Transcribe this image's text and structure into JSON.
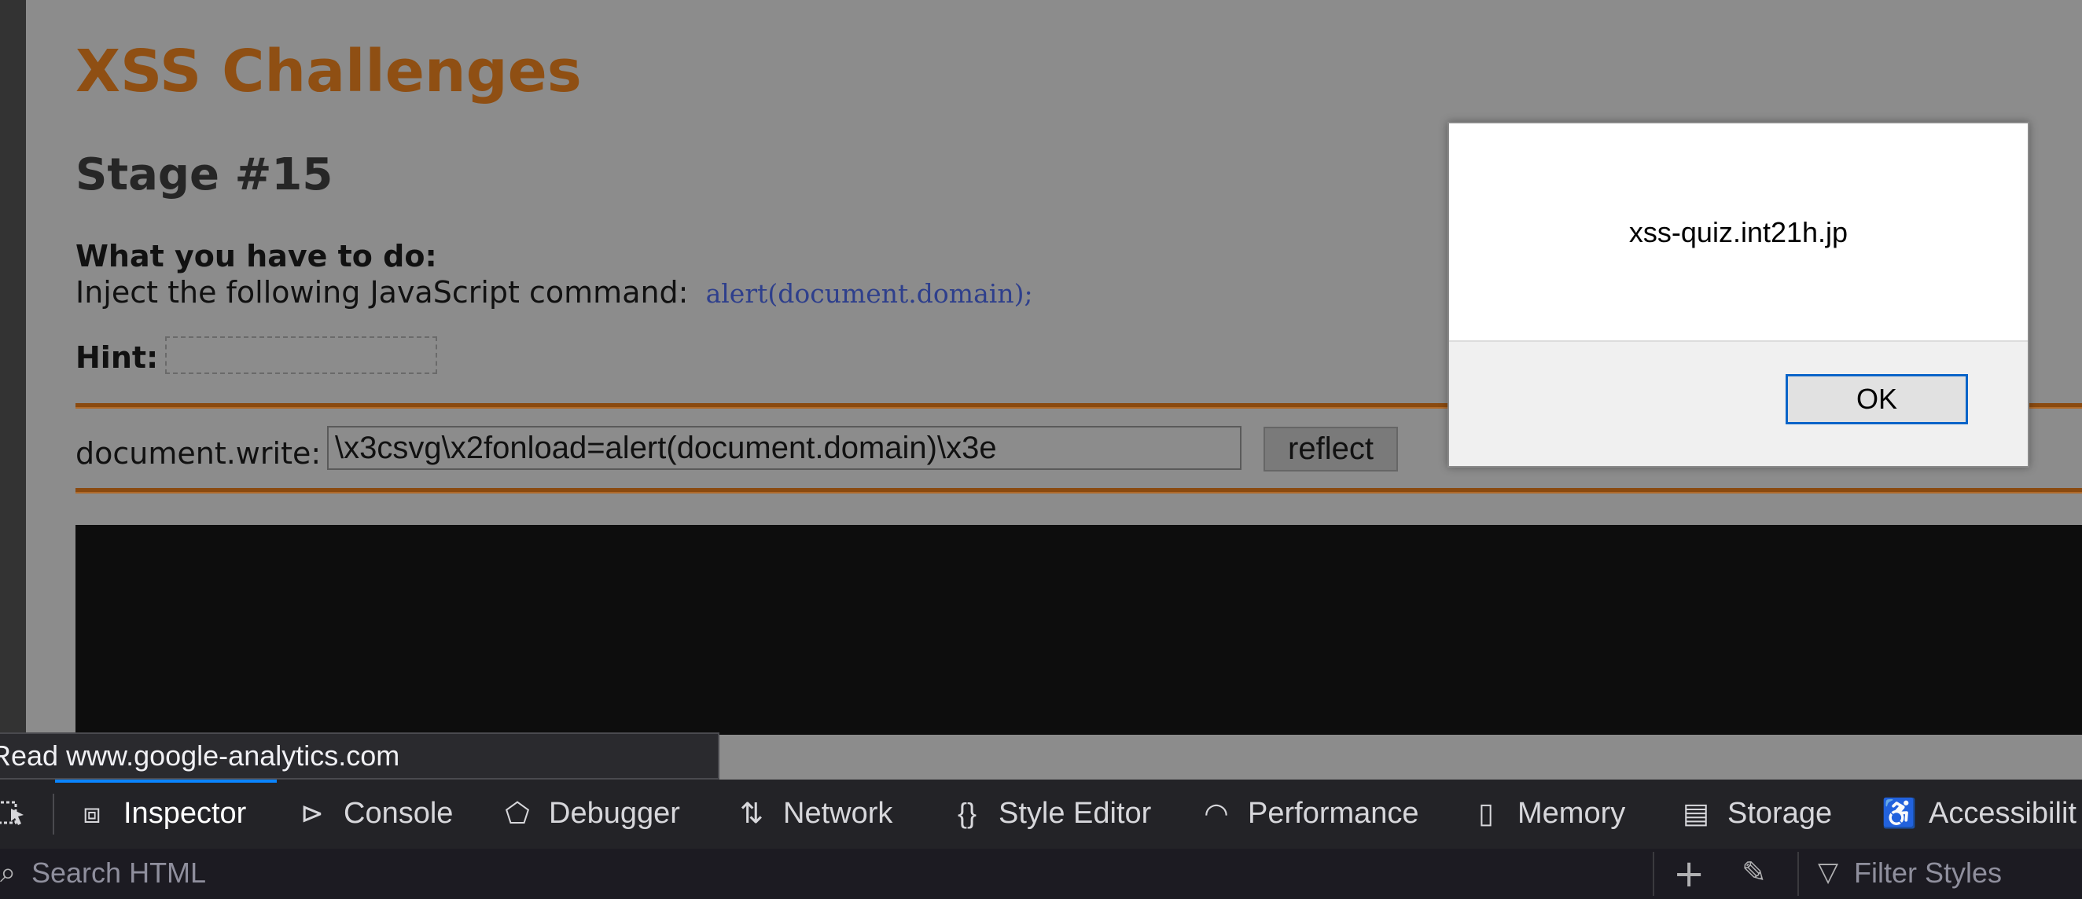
{
  "page": {
    "title": "XSS Challenges",
    "stage": "Stage #15",
    "todo_label": "What you have to do:",
    "instruction_text": "Inject the following JavaScript command:",
    "instruction_code": "alert(document.domain);",
    "hint_label": "Hint:",
    "form": {
      "label": "document.write:",
      "input_value": "\\x3csvg\\x2fonload=alert(document.domain)\\x3e",
      "submit_label": "reflect"
    }
  },
  "alert": {
    "message": "xss-quiz.int21h.jp",
    "ok_label": "OK"
  },
  "status_tip": "Read www.google-analytics.com",
  "devtools": {
    "tabs": [
      {
        "label": "Inspector",
        "icon": "inspector-icon",
        "active": true
      },
      {
        "label": "Console",
        "icon": "console-icon"
      },
      {
        "label": "Debugger",
        "icon": "debugger-icon"
      },
      {
        "label": "Network",
        "icon": "network-icon"
      },
      {
        "label": "Style Editor",
        "icon": "style-editor-icon"
      },
      {
        "label": "Performance",
        "icon": "performance-icon"
      },
      {
        "label": "Memory",
        "icon": "memory-icon"
      },
      {
        "label": "Storage",
        "icon": "storage-icon"
      },
      {
        "label": "Accessibilit",
        "icon": "accessibility-icon"
      }
    ],
    "search_placeholder": "Search HTML",
    "filter_placeholder": "Filter Styles",
    "accent_color": "#0a84ff"
  }
}
